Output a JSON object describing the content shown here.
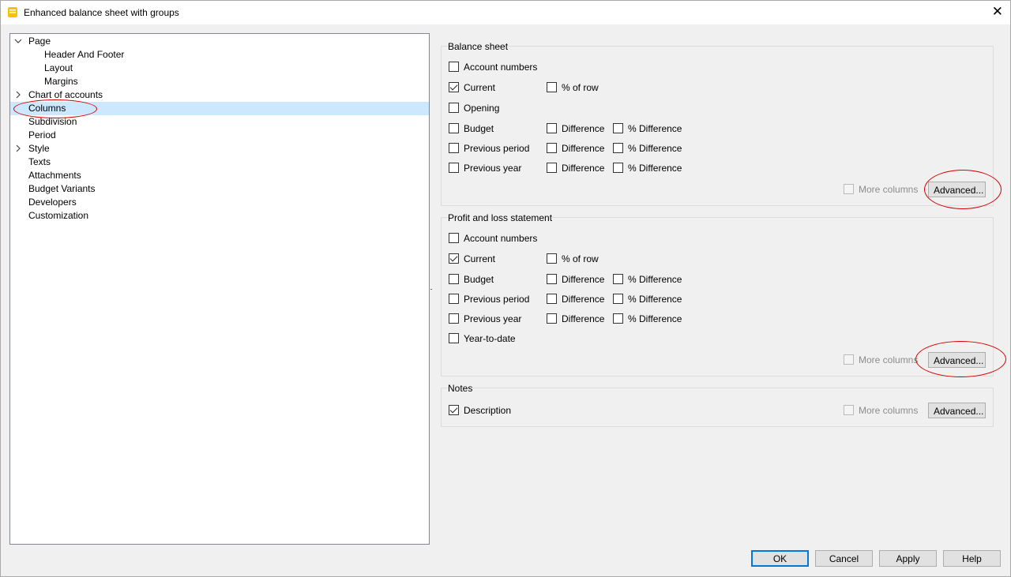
{
  "window": {
    "title": "Enhanced balance sheet with groups"
  },
  "tree": [
    {
      "label": "Page",
      "expander": "down",
      "level": 0,
      "selected": false
    },
    {
      "label": "Header And Footer",
      "expander": "",
      "level": 1,
      "selected": false
    },
    {
      "label": "Layout",
      "expander": "",
      "level": 1,
      "selected": false
    },
    {
      "label": "Margins",
      "expander": "",
      "level": 1,
      "selected": false
    },
    {
      "label": "Chart of accounts",
      "expander": "right",
      "level": 0,
      "selected": false
    },
    {
      "label": "Columns",
      "expander": "",
      "level": 0,
      "selected": true
    },
    {
      "label": "Subdivision",
      "expander": "",
      "level": 0,
      "selected": false
    },
    {
      "label": "Period",
      "expander": "",
      "level": 0,
      "selected": false
    },
    {
      "label": "Style",
      "expander": "right",
      "level": 0,
      "selected": false
    },
    {
      "label": "Texts",
      "expander": "",
      "level": 0,
      "selected": false
    },
    {
      "label": "Attachments",
      "expander": "",
      "level": 0,
      "selected": false
    },
    {
      "label": "Budget Variants",
      "expander": "",
      "level": 0,
      "selected": false
    },
    {
      "label": "Developers",
      "expander": "",
      "level": 0,
      "selected": false
    },
    {
      "label": "Customization",
      "expander": "",
      "level": 0,
      "selected": false
    }
  ],
  "balance_sheet": {
    "title": "Balance sheet",
    "rows": [
      [
        {
          "label": "Account numbers",
          "checked": false
        }
      ],
      [
        {
          "label": "Current",
          "checked": true
        },
        {
          "label": "% of row",
          "checked": false
        }
      ],
      [
        {
          "label": "Opening",
          "checked": false
        }
      ],
      [
        {
          "label": "Budget",
          "checked": false
        },
        {
          "label": "Difference",
          "checked": false
        },
        {
          "label": "% Difference",
          "checked": false
        }
      ],
      [
        {
          "label": "Previous period",
          "checked": false
        },
        {
          "label": "Difference",
          "checked": false
        },
        {
          "label": "% Difference",
          "checked": false
        }
      ],
      [
        {
          "label": "Previous year",
          "checked": false
        },
        {
          "label": "Difference",
          "checked": false
        },
        {
          "label": "% Difference",
          "checked": false
        }
      ]
    ],
    "more_columns": "More columns",
    "advanced": "Advanced..."
  },
  "profit_loss": {
    "title": "Profit and loss statement",
    "rows": [
      [
        {
          "label": "Account numbers",
          "checked": false
        }
      ],
      [
        {
          "label": "Current",
          "checked": true
        },
        {
          "label": "% of row",
          "checked": false
        }
      ],
      [
        {
          "label": "Budget",
          "checked": false
        },
        {
          "label": "Difference",
          "checked": false
        },
        {
          "label": "% Difference",
          "checked": false
        }
      ],
      [
        {
          "label": "Previous period",
          "checked": false
        },
        {
          "label": "Difference",
          "checked": false
        },
        {
          "label": "% Difference",
          "checked": false
        }
      ],
      [
        {
          "label": "Previous year",
          "checked": false
        },
        {
          "label": "Difference",
          "checked": false
        },
        {
          "label": "% Difference",
          "checked": false
        }
      ],
      [
        {
          "label": "Year-to-date",
          "checked": false
        }
      ]
    ],
    "more_columns": "More columns",
    "advanced": "Advanced..."
  },
  "notes": {
    "title": "Notes",
    "description": {
      "label": "Description",
      "checked": true
    },
    "more_columns": "More columns",
    "advanced": "Advanced..."
  },
  "buttons": {
    "ok": "OK",
    "cancel": "Cancel",
    "apply": "Apply",
    "help": "Help"
  },
  "annotation_color": "#d40000",
  "selection_color": "#cce8ff",
  "app_icon_color": "#f5c400"
}
